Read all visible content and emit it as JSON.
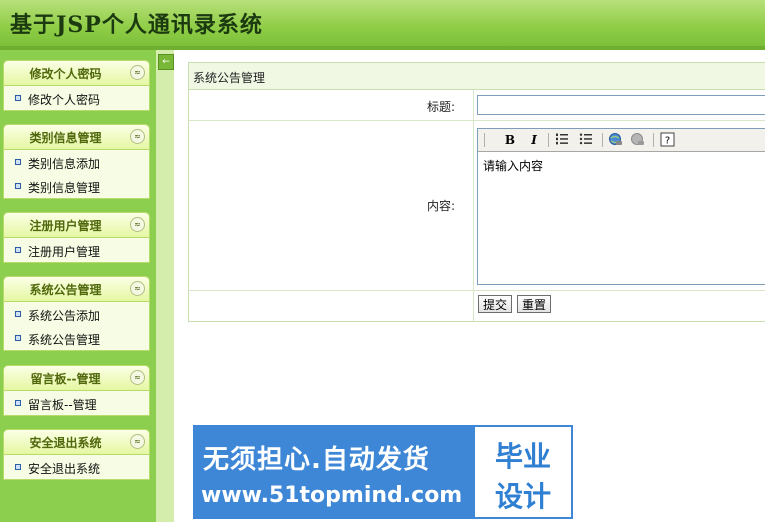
{
  "app": {
    "title": "基于JSP个人通讯录系统"
  },
  "sidebar": {
    "splitter_icon": "←",
    "sections": [
      {
        "title": "修改个人密码",
        "items": [
          "修改个人密码"
        ]
      },
      {
        "title": "类别信息管理",
        "items": [
          "类别信息添加",
          "类别信息管理"
        ]
      },
      {
        "title": "注册用户管理",
        "items": [
          "注册用户管理"
        ]
      },
      {
        "title": "系统公告管理",
        "items": [
          "系统公告添加",
          "系统公告管理"
        ]
      },
      {
        "title": "留言板--管理",
        "items": [
          "留言板--管理"
        ]
      },
      {
        "title": "安全退出系统",
        "items": [
          "安全退出系统"
        ]
      }
    ],
    "collapse_glyph": "≈"
  },
  "form": {
    "panel_title": "系统公告管理",
    "title_label": "标题:",
    "title_value": "",
    "content_label": "内容:",
    "editor_text": "请输入内容",
    "toolbar": {
      "bold": "B",
      "italic": "I"
    },
    "submit_label": "提交",
    "reset_label": "重置"
  },
  "watermark": {
    "line1": "无须担心.自动发货",
    "line2": "www.51topmind.com",
    "right1": "毕业",
    "right2": "设计"
  }
}
